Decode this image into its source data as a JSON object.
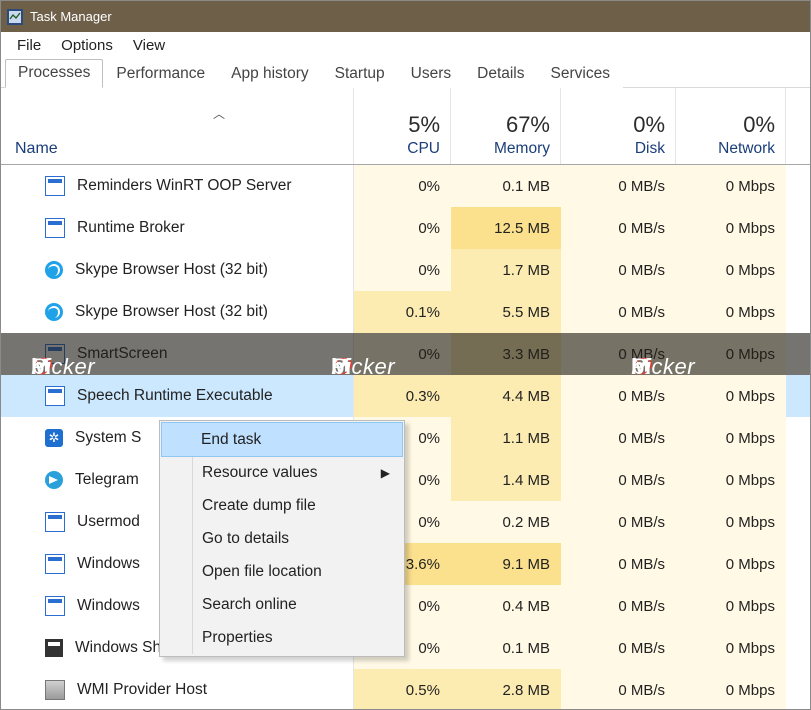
{
  "window": {
    "title": "Task Manager"
  },
  "menu": {
    "file": "File",
    "options": "Options",
    "view": "View"
  },
  "tabs": {
    "processes": "Processes",
    "performance": "Performance",
    "app_history": "App history",
    "startup": "Startup",
    "users": "Users",
    "details": "Details",
    "services": "Services"
  },
  "columns": {
    "name": "Name",
    "cpu": {
      "pct": "5%",
      "label": "CPU"
    },
    "mem": {
      "pct": "67%",
      "label": "Memory"
    },
    "disk": {
      "pct": "0%",
      "label": "Disk"
    },
    "net": {
      "pct": "0%",
      "label": "Network"
    }
  },
  "rows": [
    {
      "icon": "generic",
      "name": "Reminders WinRT OOP Server",
      "cpu": "0%",
      "mem": "0.1 MB",
      "disk": "0 MB/s",
      "net": "0 Mbps",
      "s": {
        "cpu": 0,
        "mem": 0,
        "disk": 0,
        "net": 0
      }
    },
    {
      "icon": "generic",
      "name": "Runtime Broker",
      "cpu": "0%",
      "mem": "12.5 MB",
      "disk": "0 MB/s",
      "net": "0 Mbps",
      "s": {
        "cpu": 0,
        "mem": 2,
        "disk": 0,
        "net": 0
      }
    },
    {
      "icon": "skype",
      "name": "Skype Browser Host (32 bit)",
      "cpu": "0%",
      "mem": "1.7 MB",
      "disk": "0 MB/s",
      "net": "0 Mbps",
      "s": {
        "cpu": 0,
        "mem": 1,
        "disk": 0,
        "net": 0
      }
    },
    {
      "icon": "skype",
      "name": "Skype Browser Host (32 bit)",
      "cpu": "0.1%",
      "mem": "5.5 MB",
      "disk": "0 MB/s",
      "net": "0 Mbps",
      "s": {
        "cpu": 1,
        "mem": 1,
        "disk": 0,
        "net": 0
      }
    },
    {
      "icon": "generic",
      "name": "SmartScreen",
      "cpu": "0%",
      "mem": "3.3 MB",
      "disk": "0 MB/s",
      "net": "0 Mbps",
      "s": {
        "cpu": 0,
        "mem": 1,
        "disk": 0,
        "net": 0
      },
      "watermark": true
    },
    {
      "icon": "generic",
      "name": "Speech Runtime Executable",
      "cpu": "0.3%",
      "mem": "4.4 MB",
      "disk": "0 MB/s",
      "net": "0 Mbps",
      "s": {
        "cpu": 1,
        "mem": 1,
        "disk": 0,
        "net": 0
      },
      "selected": true
    },
    {
      "icon": "gear",
      "name": "System S",
      "cpu": "0%",
      "mem": "1.1 MB",
      "disk": "0 MB/s",
      "net": "0 Mbps",
      "s": {
        "cpu": 0,
        "mem": 1,
        "disk": 0,
        "net": 0
      }
    },
    {
      "icon": "tg",
      "name": "Telegram",
      "cpu": "0%",
      "mem": "1.4 MB",
      "disk": "0 MB/s",
      "net": "0 Mbps",
      "s": {
        "cpu": 0,
        "mem": 1,
        "disk": 0,
        "net": 0
      }
    },
    {
      "icon": "generic",
      "name": "Usermod",
      "cpu": "0%",
      "mem": "0.2 MB",
      "disk": "0 MB/s",
      "net": "0 Mbps",
      "s": {
        "cpu": 0,
        "mem": 0,
        "disk": 0,
        "net": 0
      }
    },
    {
      "icon": "generic",
      "name": "Windows",
      "cpu": "3.6%",
      "mem": "9.1 MB",
      "disk": "0 MB/s",
      "net": "0 Mbps",
      "s": {
        "cpu": 2,
        "mem": 2,
        "disk": 0,
        "net": 0
      }
    },
    {
      "icon": "generic",
      "name": "Windows",
      "cpu": "0%",
      "mem": "0.4 MB",
      "disk": "0 MB/s",
      "net": "0 Mbps",
      "s": {
        "cpu": 0,
        "mem": 0,
        "disk": 0,
        "net": 0
      }
    },
    {
      "icon": "shell",
      "name": "Windows Shell Experience Host",
      "cpu": "0%",
      "mem": "0.1 MB",
      "disk": "0 MB/s",
      "net": "0 Mbps",
      "s": {
        "cpu": 0,
        "mem": 0,
        "disk": 0,
        "net": 0
      }
    },
    {
      "icon": "wmi",
      "name": "WMI Provider Host",
      "cpu": "0.5%",
      "mem": "2.8 MB",
      "disk": "0 MB/s",
      "net": "0 Mbps",
      "s": {
        "cpu": 1,
        "mem": 1,
        "disk": 0,
        "net": 0
      }
    }
  ],
  "context_menu": {
    "end_task": "End task",
    "resource_values": "Resource values",
    "create_dump": "Create dump file",
    "go_to_details": "Go to details",
    "open_file_location": "Open file location",
    "search_online": "Search online",
    "properties": "Properties"
  },
  "watermark": {
    "a": "M",
    "b": "bi",
    "c": "Picker"
  }
}
